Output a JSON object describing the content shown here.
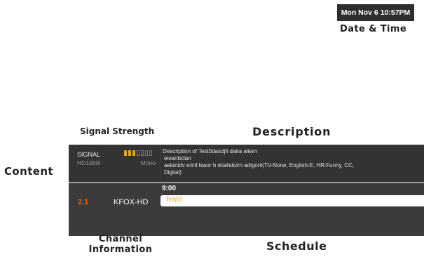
{
  "header": {
    "datetime": "Mon Nov 6 10:57PM"
  },
  "annotations": {
    "datetime": "Date & Time",
    "signal_strength": "Signal Strength",
    "description": "Description",
    "content": "Content",
    "channel_information": "Channel Information",
    "schedule": "Schedule"
  },
  "signal": {
    "label": "SIGNAL",
    "resolution": "HD1080i",
    "audio": "Mono",
    "level_segments_on": 3,
    "level_segments_total": 7,
    "meter_color": "#e8a020"
  },
  "description": {
    "lines": [
      "Description of Test0dasdjfi daira aliern",
      "eioanbclan",
      "aelanidv erinf biaor h doahdoirn adigorii(TV-None, English-E, HR:Funny, CC,",
      "Digital)"
    ]
  },
  "channel": {
    "number": "2.1",
    "name": "KFOX-HD",
    "number_color": "#e8641e"
  },
  "schedule": {
    "time": "9:00",
    "program": "Test0"
  },
  "colors": {
    "panel_bg": "#3b3b3b",
    "label_text": "#222222"
  }
}
